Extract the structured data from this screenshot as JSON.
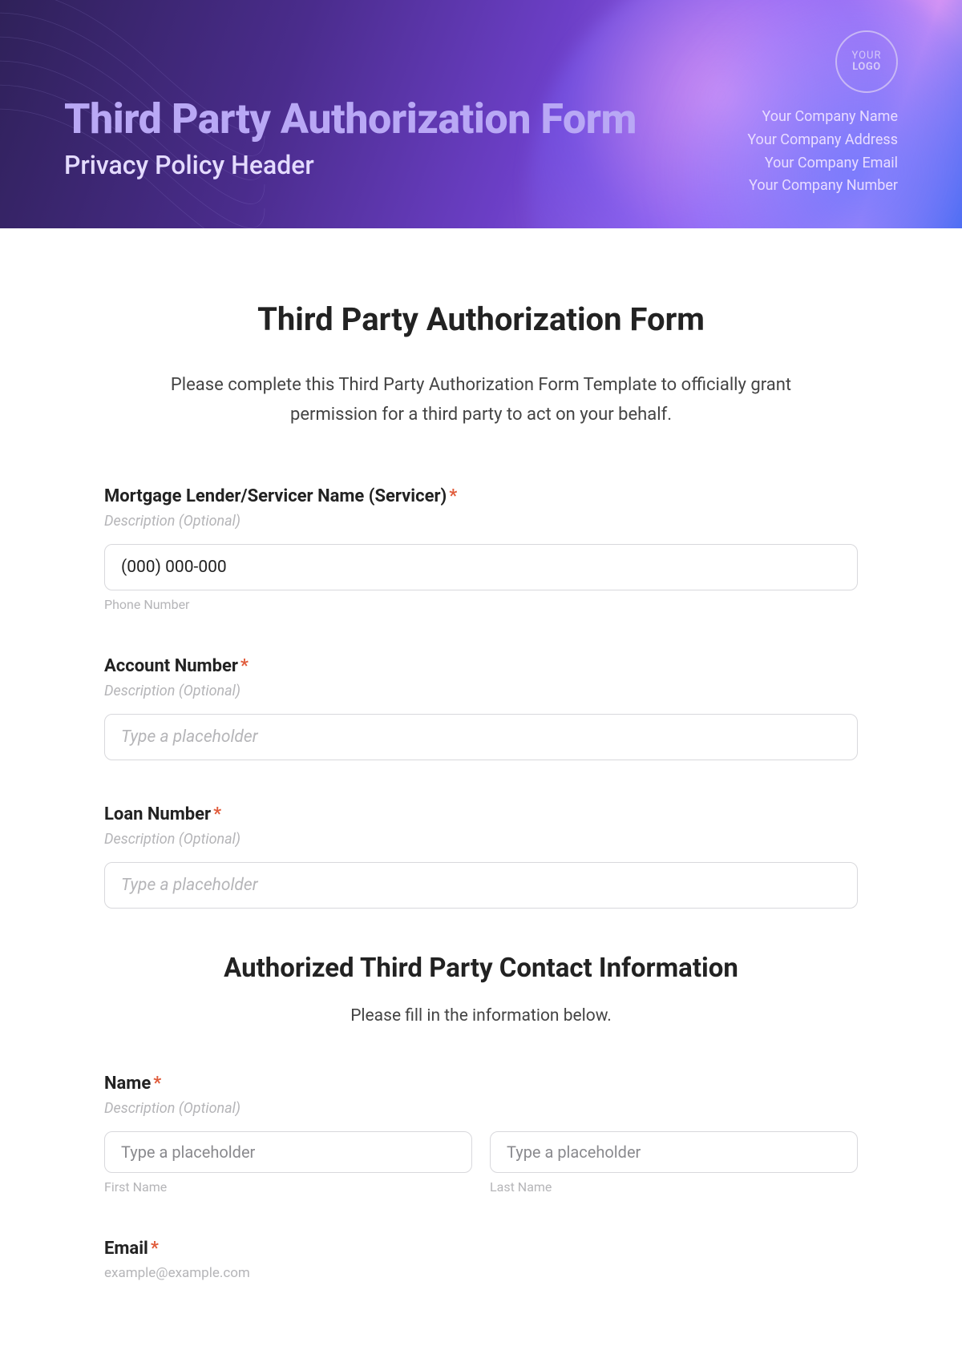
{
  "hero": {
    "title": "Third Party Authorization Form",
    "subtitle": "Privacy Policy Header",
    "logo_line1": "YOUR",
    "logo_line2": "LOGO",
    "company_name": "Your Company Name",
    "company_address": "Your Company Address",
    "company_email": "Your Company Email",
    "company_number": "Your Company Number"
  },
  "form": {
    "title": "Third Party Authorization Form",
    "intro": "Please complete this Third Party Authorization Form Template to officially grant permission for a third party to act on your behalf.",
    "required_mark": "*",
    "desc_optional": "Description (Optional)",
    "servicer": {
      "label": "Mortgage Lender/Servicer Name (Servicer)",
      "value": "(000) 000-000",
      "help": "Phone Number"
    },
    "account": {
      "label": "Account Number",
      "placeholder": "Type a placeholder"
    },
    "loan": {
      "label": "Loan Number",
      "placeholder": "Type a placeholder"
    },
    "section2": {
      "title": "Authorized Third Party Contact Information",
      "sub": "Please fill in the information below."
    },
    "name": {
      "label": "Name",
      "first_placeholder": "Type a placeholder",
      "last_placeholder": "Type a placeholder",
      "first_help": "First Name",
      "last_help": "Last Name"
    },
    "email": {
      "label": "Email",
      "example": "example@example.com"
    }
  }
}
